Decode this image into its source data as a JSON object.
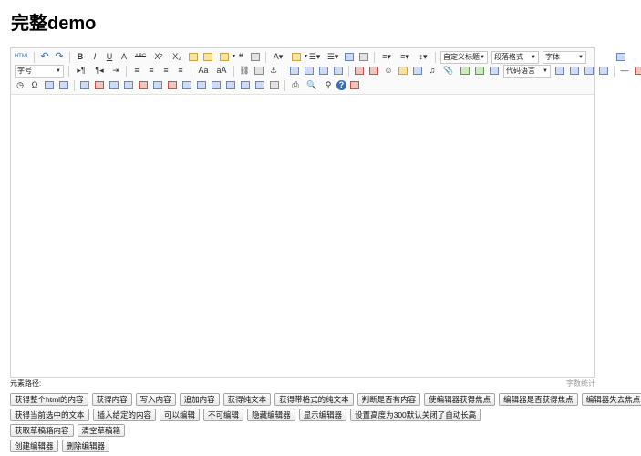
{
  "page": {
    "title": "完整demo"
  },
  "toolbar": {
    "row1": [
      {
        "name": "source-html-icon",
        "label": "HTML",
        "type": "text"
      },
      {
        "type": "sep"
      },
      {
        "name": "undo-icon",
        "label": "↶",
        "type": "text"
      },
      {
        "name": "redo-icon",
        "label": "↷",
        "type": "text"
      },
      {
        "type": "sep"
      },
      {
        "name": "bold-icon",
        "label": "B",
        "type": "text"
      },
      {
        "name": "italic-icon",
        "label": "I",
        "type": "text"
      },
      {
        "name": "underline-icon",
        "label": "U",
        "type": "text"
      },
      {
        "name": "font-border-icon",
        "label": "A",
        "type": "text"
      },
      {
        "name": "strikethrough-icon",
        "label": "ABC",
        "type": "text"
      },
      {
        "name": "superscript-icon",
        "label": "X²",
        "type": "text"
      },
      {
        "name": "subscript-icon",
        "label": "X₂",
        "type": "text"
      },
      {
        "name": "remove-format-icon",
        "type": "sq",
        "color": "yellow"
      },
      {
        "name": "format-match-icon",
        "type": "sq",
        "color": "yellow"
      },
      {
        "name": "auto-typeset-icon",
        "label": "▾",
        "type": "sq",
        "color": "yellow"
      },
      {
        "name": "blockquote-icon",
        "label": "❝",
        "type": "text"
      },
      {
        "name": "paste-plain-icon",
        "type": "sq",
        "color": "gray"
      },
      {
        "type": "sep"
      },
      {
        "name": "font-color-icon",
        "label": "A▾",
        "type": "text"
      },
      {
        "name": "background-color-icon",
        "label": "▾",
        "type": "sq",
        "color": "yellow"
      },
      {
        "name": "ordered-list-icon",
        "label": "☰▾",
        "type": "text"
      },
      {
        "name": "unordered-list-icon",
        "label": "☰▾",
        "type": "text"
      },
      {
        "name": "select-all-icon",
        "type": "sq"
      },
      {
        "name": "clear-doc-icon",
        "type": "sq",
        "color": "gray"
      },
      {
        "type": "sep"
      },
      {
        "name": "row-spacing-top-icon",
        "label": "≡▾",
        "type": "text"
      },
      {
        "name": "row-spacing-bottom-icon",
        "label": "≡▾",
        "type": "text"
      },
      {
        "name": "line-height-icon",
        "label": "↕▾",
        "type": "text"
      },
      {
        "type": "sep"
      },
      {
        "name": "custom-title-select",
        "type": "select",
        "label": "自定义标题",
        "width": 46
      },
      {
        "name": "paragraph-format-select",
        "type": "select",
        "label": "段落格式",
        "width": 46
      },
      {
        "name": "font-family-select",
        "type": "select",
        "label": "字体",
        "width": 42
      },
      {
        "type": "gap",
        "width": 28
      },
      {
        "name": "fullscreen-icon",
        "type": "sq"
      }
    ],
    "row2": [
      {
        "name": "font-size-select",
        "type": "select",
        "label": "字号",
        "width": 48
      },
      {
        "type": "sep"
      },
      {
        "name": "direction-ltr-icon",
        "label": "▸¶",
        "type": "text"
      },
      {
        "name": "direction-rtl-icon",
        "label": "¶◂",
        "type": "text"
      },
      {
        "name": "indent-icon",
        "label": "⇥",
        "type": "text"
      },
      {
        "type": "sep"
      },
      {
        "name": "justify-left-icon",
        "label": "≡",
        "type": "text"
      },
      {
        "name": "justify-center-icon",
        "label": "≡",
        "type": "text"
      },
      {
        "name": "justify-right-icon",
        "label": "≡",
        "type": "text"
      },
      {
        "name": "justify-full-icon",
        "label": "≡",
        "type": "text"
      },
      {
        "type": "sep"
      },
      {
        "name": "to-upper-case-icon",
        "label": "Aa",
        "type": "text"
      },
      {
        "name": "to-lower-case-icon",
        "label": "aA",
        "type": "text"
      },
      {
        "type": "sep"
      },
      {
        "name": "link-icon",
        "label": "⛓",
        "type": "text"
      },
      {
        "name": "unlink-icon",
        "type": "sq",
        "color": "gray"
      },
      {
        "name": "anchor-icon",
        "label": "⚓",
        "type": "text"
      },
      {
        "type": "sep"
      },
      {
        "name": "image-none-icon",
        "type": "sq"
      },
      {
        "name": "image-left-icon",
        "type": "sq"
      },
      {
        "name": "image-right-icon",
        "type": "sq"
      },
      {
        "name": "image-center-icon",
        "type": "sq"
      },
      {
        "type": "sep"
      },
      {
        "name": "simple-upload-icon",
        "type": "sq",
        "color": "red"
      },
      {
        "name": "insert-image-icon",
        "type": "sq",
        "color": "red"
      },
      {
        "name": "emotion-icon",
        "label": "☺",
        "type": "text"
      },
      {
        "name": "scrawl-icon",
        "type": "sq",
        "color": "yellow"
      },
      {
        "name": "insert-video-icon",
        "type": "sq"
      },
      {
        "name": "music-icon",
        "label": "♫",
        "type": "text"
      },
      {
        "name": "attachment-icon",
        "label": "📎",
        "type": "text"
      },
      {
        "name": "map-icon",
        "type": "sq",
        "color": "green"
      },
      {
        "name": "gmap-icon",
        "type": "sq",
        "color": "green"
      },
      {
        "name": "insert-frame-icon",
        "type": "sq"
      },
      {
        "name": "insert-code-select",
        "type": "select",
        "label": "代码语言",
        "width": 46
      },
      {
        "name": "page-break-icon",
        "type": "sq"
      },
      {
        "name": "template-icon",
        "type": "sq"
      },
      {
        "name": "background-icon",
        "type": "sq"
      },
      {
        "name": "drafts-icon",
        "type": "sq"
      },
      {
        "type": "sep"
      },
      {
        "name": "horizontal-icon",
        "label": "—",
        "type": "text"
      },
      {
        "name": "date-icon",
        "type": "sq",
        "color": "red"
      }
    ],
    "row3": [
      {
        "name": "time-icon",
        "label": "◷",
        "type": "text"
      },
      {
        "name": "special-chars-icon",
        "label": "Ω",
        "type": "text"
      },
      {
        "name": "wordimage-icon",
        "type": "sq"
      },
      {
        "name": "edittip-icon",
        "type": "sq"
      },
      {
        "type": "sep"
      },
      {
        "name": "insert-table-icon",
        "type": "sq"
      },
      {
        "name": "delete-table-icon",
        "type": "sq",
        "color": "red"
      },
      {
        "name": "insert-paragraph-before-table-icon",
        "type": "sq"
      },
      {
        "name": "insert-row-icon",
        "type": "sq"
      },
      {
        "name": "delete-row-icon",
        "type": "sq",
        "color": "red"
      },
      {
        "name": "insert-col-icon",
        "type": "sq"
      },
      {
        "name": "delete-col-icon",
        "type": "sq",
        "color": "red"
      },
      {
        "name": "merge-cells-icon",
        "type": "sq"
      },
      {
        "name": "merge-right-icon",
        "type": "sq"
      },
      {
        "name": "merge-down-icon",
        "type": "sq"
      },
      {
        "name": "split-to-cells-icon",
        "type": "sq"
      },
      {
        "name": "split-to-rows-icon",
        "type": "sq"
      },
      {
        "name": "split-to-cols-icon",
        "type": "sq"
      },
      {
        "name": "chart-icon",
        "type": "sq",
        "color": "gray"
      },
      {
        "type": "sep"
      },
      {
        "name": "print-icon",
        "label": "⎙",
        "type": "text"
      },
      {
        "name": "preview-icon",
        "label": "🔍",
        "type": "text"
      },
      {
        "name": "search-replace-icon",
        "label": "⚲",
        "type": "text"
      },
      {
        "name": "help-icon",
        "label": "?",
        "type": "text"
      },
      {
        "name": "drafts-icon-2",
        "type": "sq",
        "color": "red"
      }
    ]
  },
  "status": {
    "path_label": "元素路径:",
    "word_count": "字数统计"
  },
  "buttons": {
    "row1": [
      "获得整个html的内容",
      "获得内容",
      "写入内容",
      "追加内容",
      "获得纯文本",
      "获得带格式的纯文本",
      "判断是否有内容",
      "使编辑器获得焦点",
      "编辑器是否获得焦点",
      "编辑器失去焦点"
    ],
    "row2": [
      "获得当前选中的文本",
      "插入给定的内容",
      "可以编辑",
      "不可编辑",
      "隐藏编辑器",
      "显示编辑器",
      "设置高度为300默认关闭了自动长高"
    ],
    "row3": [
      "获取草稿箱内容",
      "清空草稿箱"
    ],
    "row4": [
      "创建编辑器",
      "删除编辑器"
    ]
  }
}
